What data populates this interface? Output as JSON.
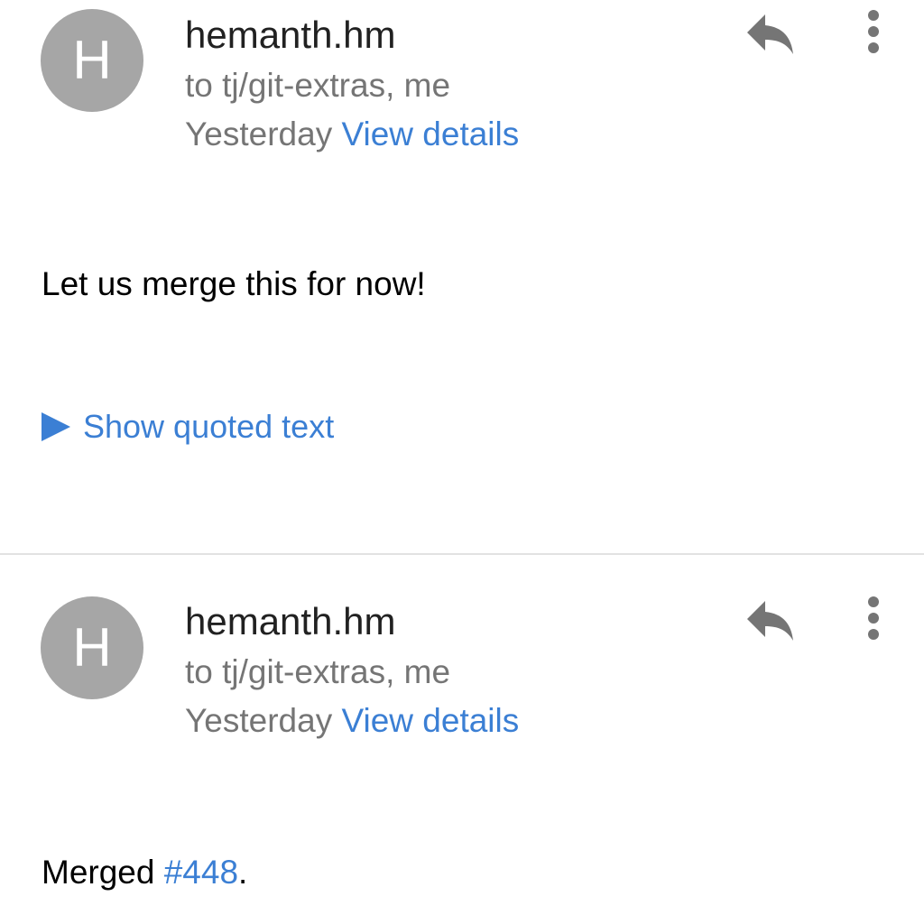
{
  "messages": [
    {
      "avatar_letter": "H",
      "sender": "hemanth.hm",
      "recipients": "to tj/git-extras, me",
      "date": "Yesterday",
      "view_details": "View details",
      "body": "Let us merge this for now!",
      "show_quoted": "Show quoted text",
      "icons": {
        "reply": "reply-icon",
        "more": "more-vert-icon",
        "toggle": "triangle-right-icon"
      }
    },
    {
      "avatar_letter": "H",
      "sender": "hemanth.hm",
      "recipients": "to tj/git-extras, me",
      "date": "Yesterday",
      "view_details": "View details",
      "body_prefix": "Merged",
      "body_link": "#448",
      "body_suffix": ".",
      "icons": {
        "reply": "reply-icon",
        "more": "more-vert-icon"
      }
    }
  ],
  "colors": {
    "link": "#3b7fd4",
    "avatar_bg": "#a6a6a6",
    "secondary_text": "#757575",
    "primary_text": "#212121",
    "divider": "#e2e2e2"
  }
}
